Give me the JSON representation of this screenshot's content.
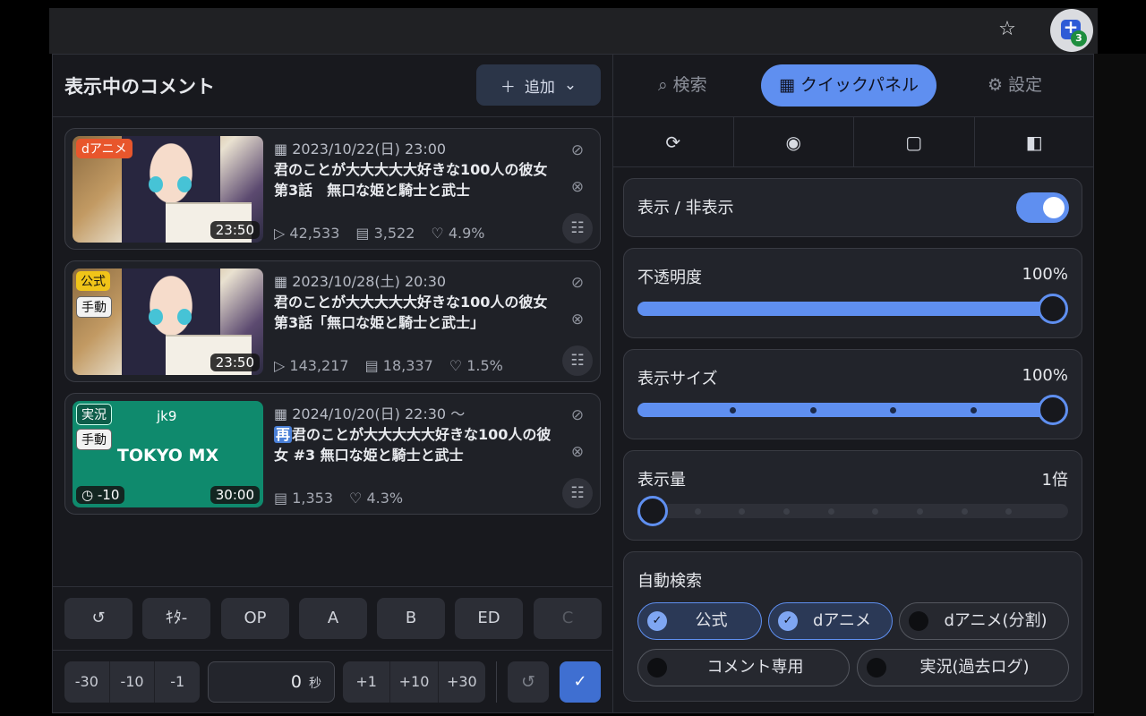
{
  "browser": {
    "star_icon": "star-icon",
    "extension_badge": "3"
  },
  "left": {
    "title": "表示中のコメント",
    "add_label": "追加",
    "cards": [
      {
        "badges": [
          "dアニメ"
        ],
        "duration": "23:50",
        "date": "2023/10/22(日) 23:00",
        "title": "君のことが大大大大大好きな100人の彼女　第3話　無口な姫と騎士と武士",
        "views": "42,533",
        "comments": "3,522",
        "likes": "4.9%"
      },
      {
        "badges": [
          "公式",
          "手動"
        ],
        "duration": "23:50",
        "date": "2023/10/28(土) 20:30",
        "title": "君のことが大大大大大好きな100人の彼女 第3話「無口な姫と騎士と武士」",
        "views": "143,217",
        "comments": "18,337",
        "likes": "1.5%"
      },
      {
        "badges": [
          "実況",
          "手動"
        ],
        "channel": "jk9",
        "station": "TOKYO MX",
        "offset": "-10",
        "duration": "30:00",
        "date": "2024/10/20(日) 22:30 〜",
        "rerun": "再",
        "title": "君のことが大大大大大好きな100人の彼女 #3 無口な姫と騎士と武士",
        "comments": "1,353",
        "likes": "4.3%"
      }
    ],
    "jump_buttons": [
      "ｷﾀ-",
      "OP",
      "A",
      "B",
      "ED",
      "C"
    ],
    "seek_minus": [
      "-30",
      "-10",
      "-1"
    ],
    "seek_plus": [
      "+1",
      "+10",
      "+30"
    ],
    "offset_value": "0",
    "offset_unit": "秒"
  },
  "right": {
    "tabs": [
      "検索",
      "クイックパネル",
      "設定"
    ],
    "active_tab": "クイックパネル",
    "toggle_label": "表示 / 非表示",
    "toggle_on": true,
    "opacity": {
      "label": "不透明度",
      "value": "100%",
      "level": 1.0
    },
    "size": {
      "label": "表示サイズ",
      "value": "100%",
      "level": 1.0
    },
    "amount": {
      "label": "表示量",
      "value": "1倍",
      "level": 0.0
    },
    "auto_search": {
      "label": "自動検索",
      "chips": [
        {
          "label": "公式",
          "on": true
        },
        {
          "label": "dアニメ",
          "on": true
        },
        {
          "label": "dアニメ(分割)",
          "on": false
        },
        {
          "label": "コメント専用",
          "on": false
        },
        {
          "label": "実況(過去ログ)",
          "on": false
        }
      ]
    }
  },
  "colors": {
    "accent": "#5f8ff0",
    "panel_bg": "#18191e",
    "badge_danime": "#e8562c",
    "badge_official": "#f0c419",
    "tv_thumb": "#0f8a6d"
  }
}
